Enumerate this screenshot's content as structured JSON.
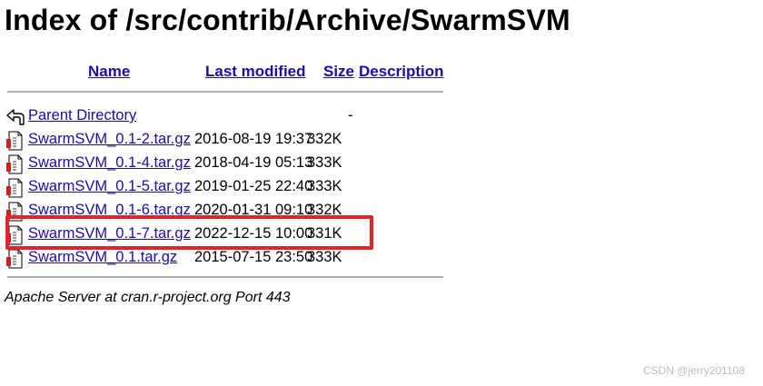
{
  "page_title": "Index of /src/contrib/Archive/SwarmSVM",
  "columns": {
    "name": "Name",
    "last_modified": "Last modified",
    "size": "Size",
    "description": "Description"
  },
  "parent": {
    "label": "Parent Directory",
    "size": "-"
  },
  "files": [
    {
      "name": "SwarmSVM_0.1-2.tar.gz",
      "modified": "2016-08-19 19:37",
      "size": "332K"
    },
    {
      "name": "SwarmSVM_0.1-4.tar.gz",
      "modified": "2018-04-19 05:13",
      "size": "333K"
    },
    {
      "name": "SwarmSVM_0.1-5.tar.gz",
      "modified": "2019-01-25 22:40",
      "size": "333K"
    },
    {
      "name": "SwarmSVM_0.1-6.tar.gz",
      "modified": "2020-01-31 09:10",
      "size": "332K"
    },
    {
      "name": "SwarmSVM_0.1-7.tar.gz",
      "modified": "2022-12-15 10:00",
      "size": "331K"
    },
    {
      "name": "SwarmSVM_0.1.tar.gz",
      "modified": "2015-07-15 23:50",
      "size": "333K"
    }
  ],
  "footer": "Apache Server at cran.r-project.org Port 443",
  "watermark": "CSDN @jerry201108",
  "colors": {
    "link": "#1a0dab",
    "highlight": "#e0252f"
  },
  "icons": {
    "parent": "back-arrow-icon",
    "file": "compressed-file-icon"
  }
}
